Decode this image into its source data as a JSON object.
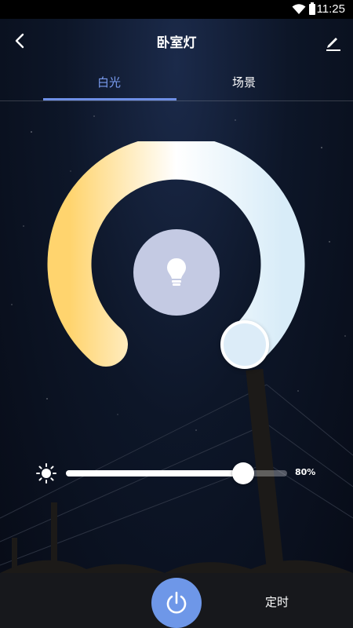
{
  "status": {
    "time": "11:25"
  },
  "header": {
    "title": "卧室灯"
  },
  "tabs": [
    {
      "label": "白光",
      "active": true
    },
    {
      "label": "场景",
      "active": false
    }
  ],
  "colors": {
    "accent": "#6e8fe6",
    "dial_warm": "#ffd46e",
    "dial_cool": "#d8ecf8",
    "bulb_bg": "#c4cae3",
    "power": "#6e97e8"
  },
  "brightness": {
    "value": 0.8,
    "label": "80%"
  },
  "bottom": {
    "timer_label": "定时"
  },
  "icons": {
    "back": "back-arrow-icon",
    "edit": "edit-icon",
    "bulb": "bulb-icon",
    "sun": "brightness-icon",
    "power": "power-icon"
  }
}
